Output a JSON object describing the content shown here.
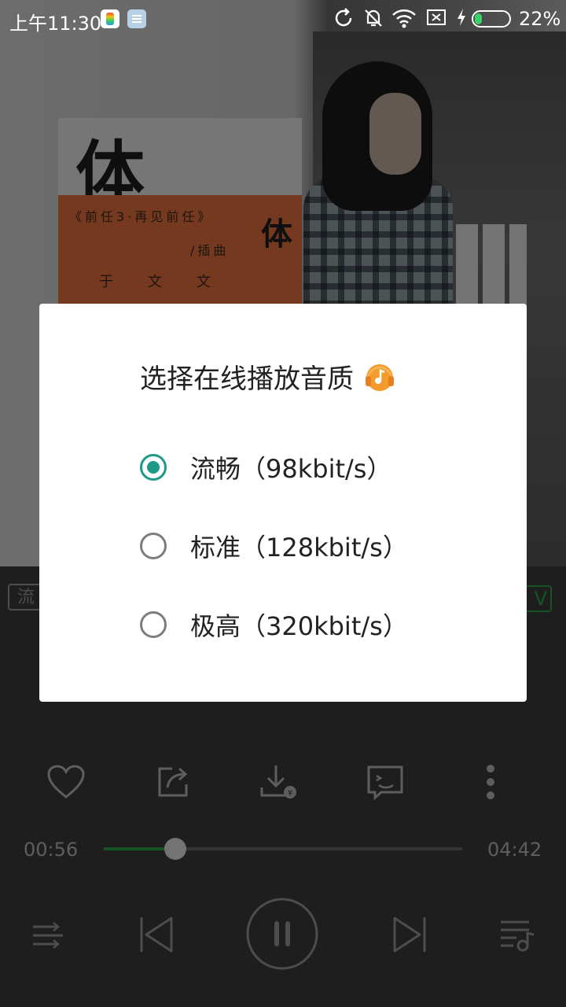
{
  "status_bar": {
    "time": "上午11:30",
    "battery_percent": "22%",
    "battery_level": 0.22,
    "icons": [
      "sync-icon",
      "mute-bell-icon",
      "wifi-icon",
      "sim-off-icon",
      "charging-icon",
      "battery-icon"
    ]
  },
  "artwork": {
    "poster_big": "体",
    "poster_line": "《前任3·再见前任》",
    "poster_sub": "/插曲",
    "poster_side": "体",
    "poster_author": "于文文"
  },
  "player": {
    "quality_tag": "流",
    "mv_tag": "V",
    "current_time": "00:56",
    "total_time": "04:42",
    "progress": 0.2,
    "actions": [
      "heart-icon",
      "share-icon",
      "download-icon",
      "comment-icon",
      "more-icon"
    ],
    "controls": [
      "play-mode-icon",
      "previous-icon",
      "pause-icon",
      "next-icon",
      "playlist-icon"
    ]
  },
  "dialog": {
    "title": "选择在线播放音质",
    "options": [
      {
        "label": "流畅（98kbit/s）",
        "selected": true
      },
      {
        "label": "标准（128kbit/s）",
        "selected": false
      },
      {
        "label": "极高（320kbit/s）",
        "selected": false
      }
    ]
  },
  "colors": {
    "accent": "#1c9a86",
    "progress": "#2ca84a",
    "headphone": "#f39c2b"
  }
}
